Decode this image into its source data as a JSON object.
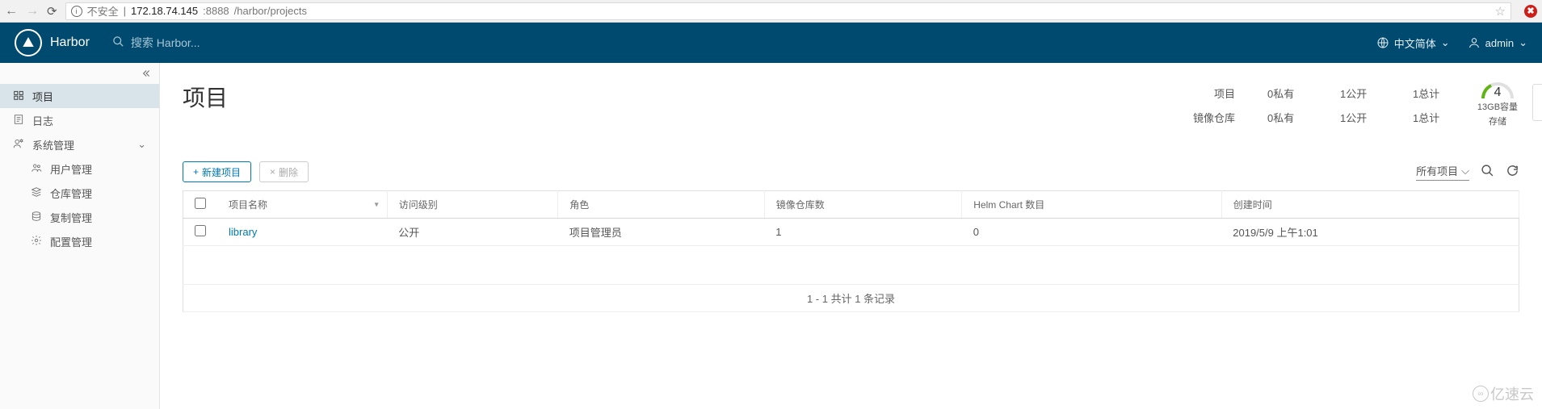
{
  "browser": {
    "insecure_label": "不安全",
    "url_host": "172.18.74.145",
    "url_port": ":8888",
    "url_path": "/harbor/projects"
  },
  "header": {
    "app_name": "Harbor",
    "search_placeholder": "搜索 Harbor...",
    "lang_label": "中文简体",
    "user_label": "admin"
  },
  "sidebar": {
    "projects": "项目",
    "logs": "日志",
    "admin": "系统管理",
    "users": "用户管理",
    "repos": "仓库管理",
    "replication": "复制管理",
    "config": "配置管理"
  },
  "page": {
    "title": "项目",
    "stats": {
      "row1_label": "项目",
      "row2_label": "镜像仓库",
      "private_1": "0私有",
      "public_1": "1公开",
      "total_1": "1总计",
      "private_2": "0私有",
      "public_2": "1公开",
      "total_2": "1总计"
    },
    "gauge": {
      "value": "4",
      "capacity": "13GB容量",
      "storage": "存储"
    },
    "toolbar": {
      "new_project": "新建项目",
      "delete": "删除",
      "filter_dropdown": "所有项目"
    },
    "table": {
      "headers": {
        "name": "项目名称",
        "access": "访问级别",
        "role": "角色",
        "repo_count": "镜像仓库数",
        "chart_count": "Helm Chart 数目",
        "created": "创建时间"
      },
      "rows": [
        {
          "name": "library",
          "access": "公开",
          "role": "项目管理员",
          "repo_count": "1",
          "chart_count": "0",
          "created": "2019/5/9 上午1:01"
        }
      ],
      "footer": "1 - 1 共计 1 条记录"
    }
  },
  "watermark": "亿速云"
}
